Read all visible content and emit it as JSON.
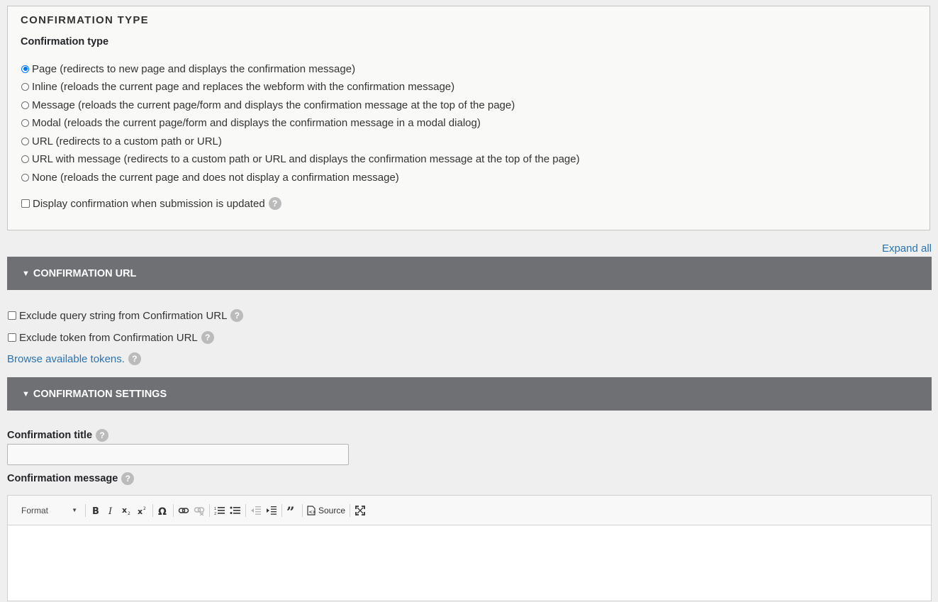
{
  "confirmation_type": {
    "legend": "CONFIRMATION TYPE",
    "group_label": "Confirmation type",
    "options": [
      {
        "label": "Page (redirects to new page and displays the confirmation message)",
        "checked": true
      },
      {
        "label": "Inline (reloads the current page and replaces the webform with the confirmation message)",
        "checked": false
      },
      {
        "label": "Message (reloads the current page/form and displays the confirmation message at the top of the page)",
        "checked": false
      },
      {
        "label": "Modal (reloads the current page/form and displays the confirmation message in a modal dialog)",
        "checked": false
      },
      {
        "label": "URL (redirects to a custom path or URL)",
        "checked": false
      },
      {
        "label": "URL with message (redirects to a custom path or URL and displays the confirmation message at the top of the page)",
        "checked": false
      },
      {
        "label": "None (reloads the current page and does not display a confirmation message)",
        "checked": false
      }
    ],
    "display_on_update_label": "Display confirmation when submission is updated"
  },
  "expand_all": "Expand all",
  "confirmation_url": {
    "summary": "CONFIRMATION URL",
    "exclude_query_label": "Exclude query string from Confirmation URL",
    "exclude_token_label": "Exclude token from Confirmation URL",
    "browse_tokens": "Browse available tokens."
  },
  "confirmation_settings": {
    "summary": "CONFIRMATION SETTINGS",
    "title_label": "Confirmation title",
    "title_value": "",
    "message_label": "Confirmation message"
  },
  "editor_toolbar": {
    "format_label": "Format",
    "source_label": "Source"
  },
  "help_glyph": "?",
  "toggle_glyph": "▼",
  "icons": [
    "radio-icon",
    "help-icon",
    "bold-icon",
    "italic-icon",
    "subscript-icon",
    "superscript-icon",
    "special-char-icon",
    "link-icon",
    "unlink-icon",
    "numbered-list-icon",
    "bulleted-list-icon",
    "outdent-icon",
    "indent-icon",
    "blockquote-icon",
    "source-icon",
    "maximize-icon"
  ],
  "colors": {
    "accent": "#0075ff",
    "link": "#2a73b2",
    "summary_bar": "#6f7074",
    "help": "#bbbbbb"
  }
}
